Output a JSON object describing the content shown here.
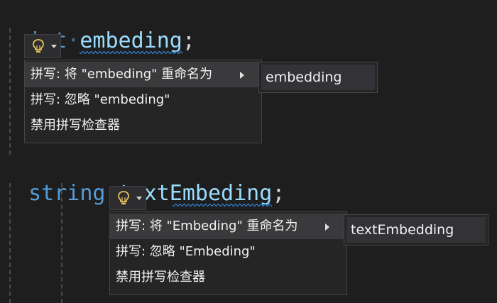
{
  "editor": {
    "line1": {
      "keyword": "int",
      "dot": "·",
      "identifier": "embeding",
      "semicolon": ";"
    },
    "line2": {
      "keyword": "string",
      "dot": "·",
      "identifier": "textEmbeding",
      "semicolon": ";"
    }
  },
  "quick_actions_1": {
    "bulb_icon": "lightbulb-icon",
    "items": [
      {
        "label": "拼写: 将 \"embeding\" 重命名为"
      },
      {
        "label": "拼写: 忽略 \"embeding\""
      },
      {
        "label": "禁用拼写检查器"
      }
    ],
    "suggestion": "embedding"
  },
  "quick_actions_2": {
    "bulb_icon": "lightbulb-icon",
    "items": [
      {
        "label": "拼写: 将 \"Embeding\" 重命名为"
      },
      {
        "label": "拼写: 忽略 \"Embeding\""
      },
      {
        "label": "禁用拼写检查器"
      }
    ],
    "suggestion": "textEmbedding"
  },
  "colors": {
    "background": "#1e1e1e",
    "keyword": "#569cd6",
    "identifier": "#9cdcfe",
    "squiggle": "#2f86d8",
    "menu_bg": "#252526",
    "menu_selected": "#3a3a3c"
  }
}
